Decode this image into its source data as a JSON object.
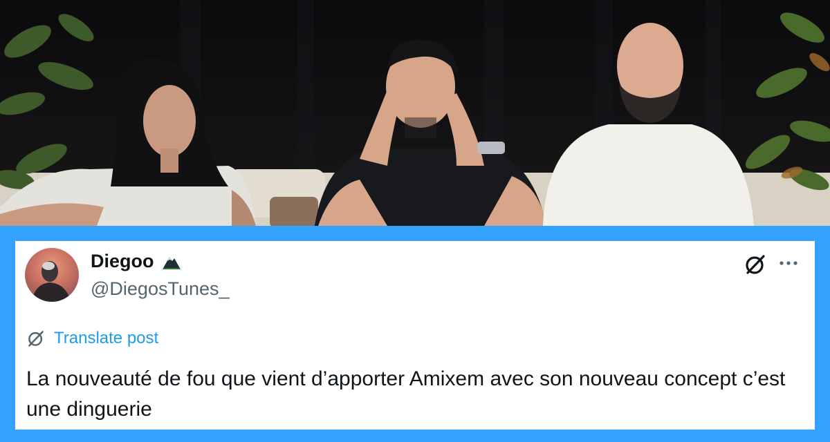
{
  "post": {
    "author": {
      "display_name": "Diegoo",
      "badge_icon": "mountain-icon",
      "handle": "@DiegosTunes_",
      "avatar_icon": "avatar-photo"
    },
    "translate_label": "Translate post",
    "text": "La nouveauté de fou que vient d’apporter Amixem avec son nouveau concept c’est une dinguerie",
    "actions": {
      "grok_icon": "grok-icon",
      "more_icon": "more-icon"
    }
  },
  "colors": {
    "frame": "#33a3ff",
    "link": "#1d9bf0",
    "text": "#0f1419",
    "secondary": "#536471"
  }
}
